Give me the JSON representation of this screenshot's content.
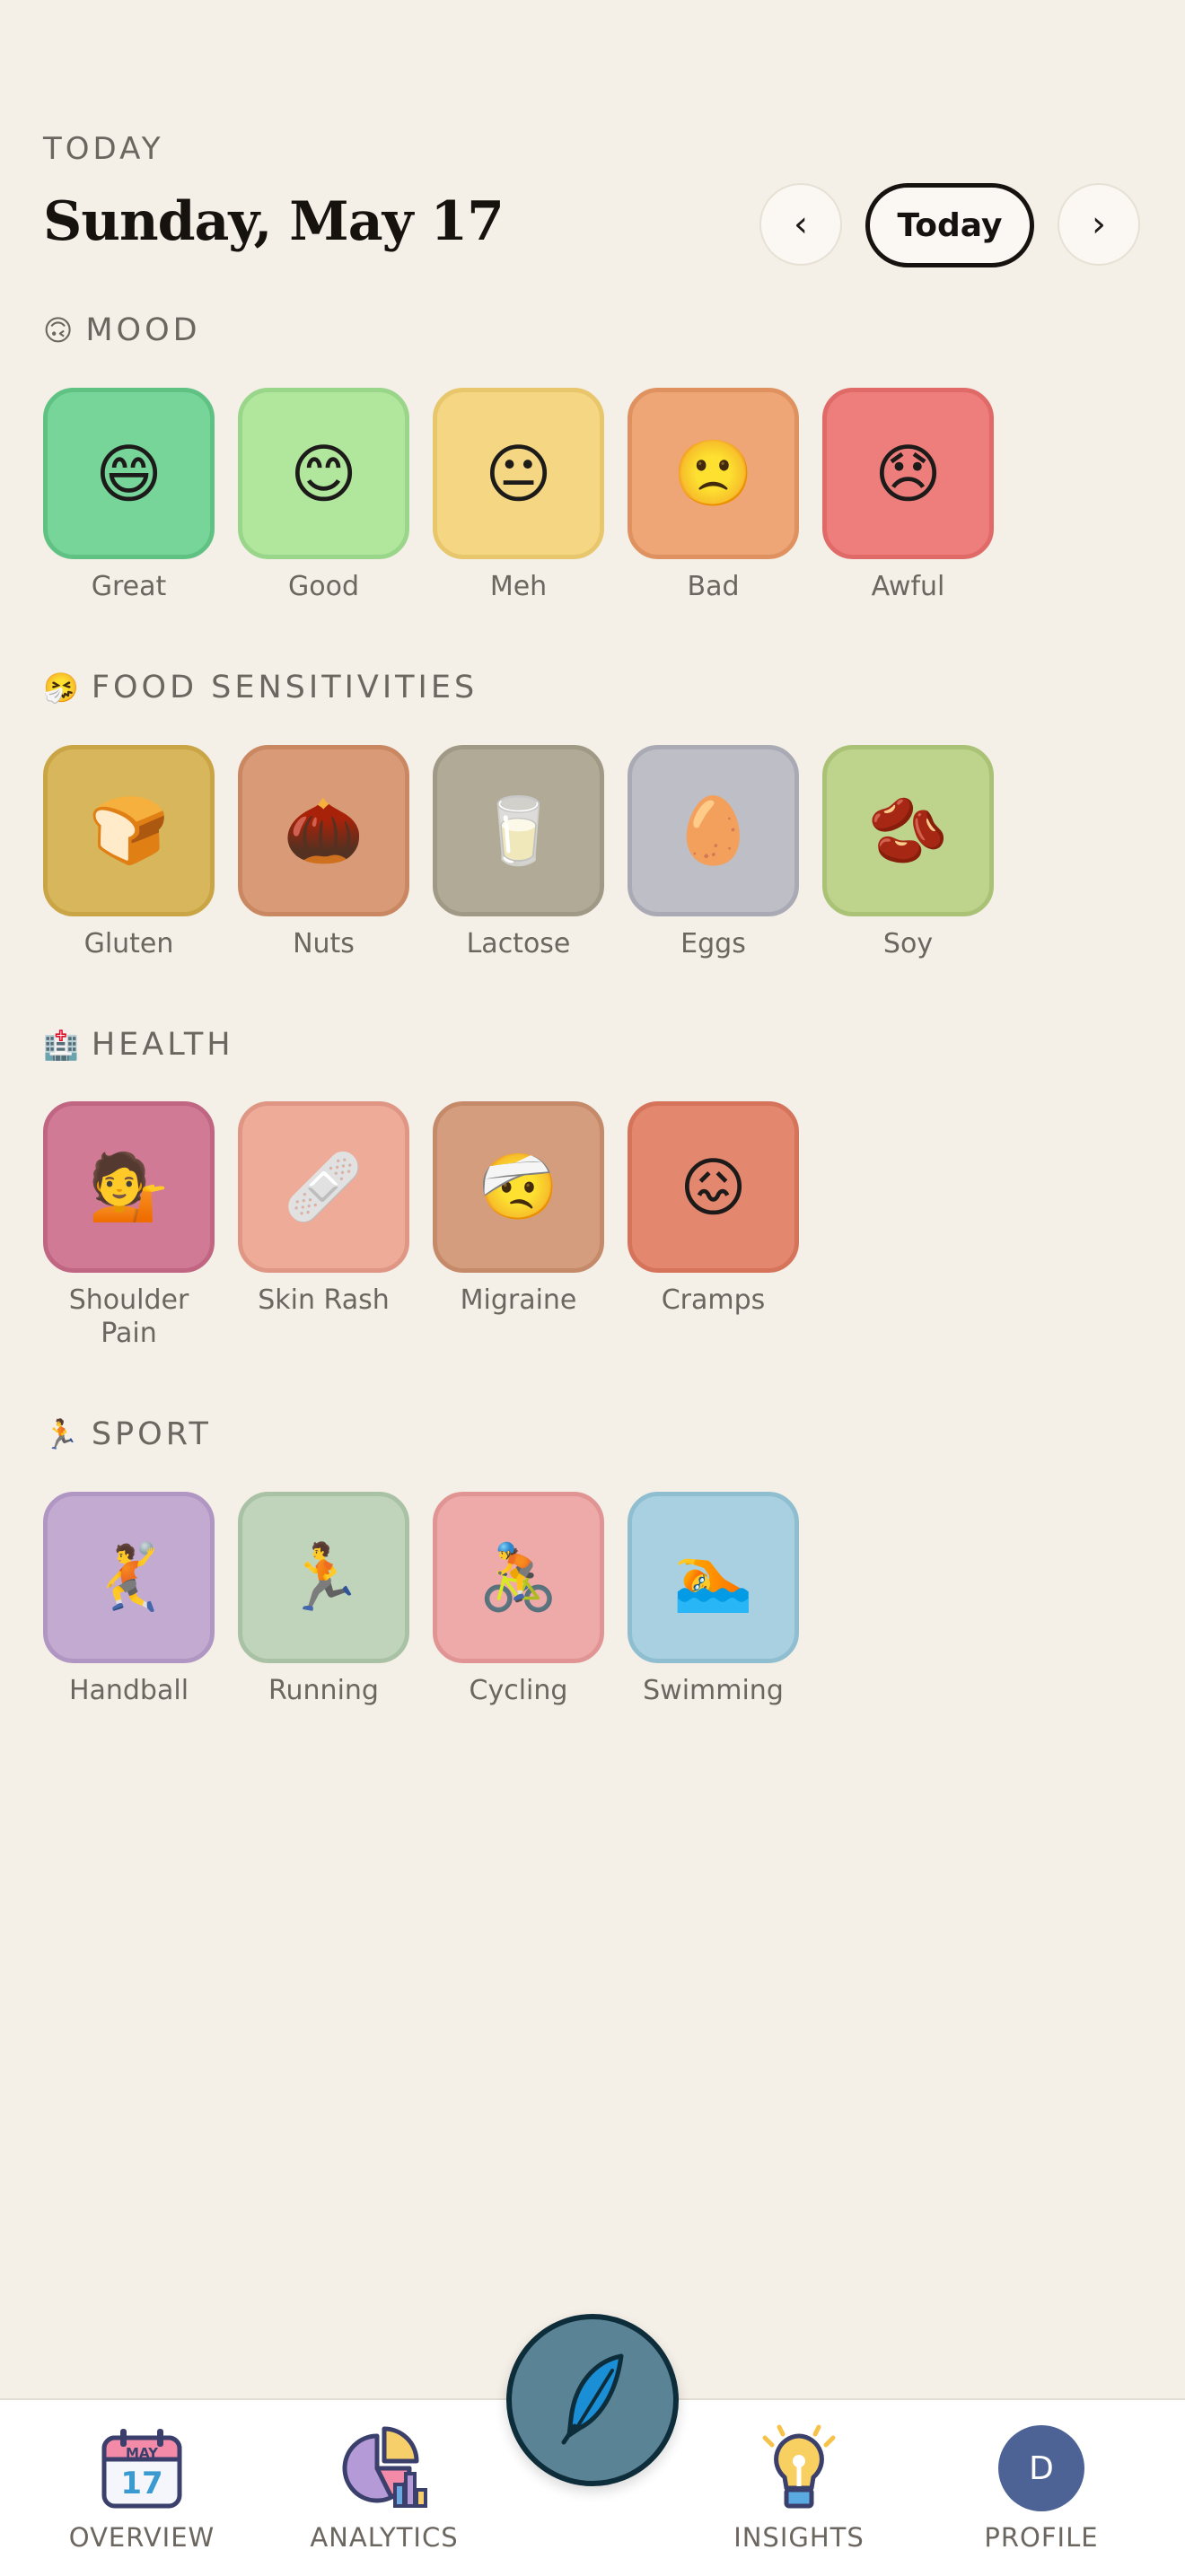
{
  "header": {
    "eyebrow": "TODAY",
    "date_title": "Sunday, May 17",
    "prev_label": "‹",
    "today_label": "Today",
    "next_label": "›"
  },
  "sections": {
    "mood": {
      "icon": "🙃",
      "title": "MOOD",
      "items": [
        {
          "label": "Great",
          "emoji": "😄",
          "bg": "#77d59a",
          "border": "#5fc283"
        },
        {
          "label": "Good",
          "emoji": "😊",
          "bg": "#b1e69d",
          "border": "#9ad68a"
        },
        {
          "label": "Meh",
          "emoji": "😐",
          "bg": "#f5d682",
          "border": "#e8c66b"
        },
        {
          "label": "Bad",
          "emoji": "🙁",
          "bg": "#eea677",
          "border": "#df925f"
        },
        {
          "label": "Awful",
          "emoji": "😞",
          "bg": "#ed7e7b",
          "border": "#e06a68"
        }
      ]
    },
    "food": {
      "icon": "🤧",
      "title": "FOOD SENSITIVITIES",
      "items": [
        {
          "label": "Gluten",
          "emoji": "🍞",
          "bg": "#d8b65b",
          "border": "#c9a546"
        },
        {
          "label": "Nuts",
          "emoji": "🌰",
          "bg": "#d99b77",
          "border": "#c98862"
        },
        {
          "label": "Lactose",
          "emoji": "🥛",
          "bg": "#b0aa97",
          "border": "#9f9985"
        },
        {
          "label": "Eggs",
          "emoji": "🥚",
          "bg": "#bdbec6",
          "border": "#a9aab4"
        },
        {
          "label": "Soy",
          "emoji": "🫘",
          "bg": "#bed38c",
          "border": "#a9c275"
        }
      ]
    },
    "health": {
      "icon": "🏥",
      "title": "HEALTH",
      "items": [
        {
          "label": "Shoulder Pain",
          "emoji": "💁",
          "bg": "#d07a95",
          "border": "#c06582"
        },
        {
          "label": "Skin Rash",
          "emoji": "🩹",
          "bg": "#edab98",
          "border": "#df9684"
        },
        {
          "label": "Migraine",
          "emoji": "🤕",
          "bg": "#d49e7e",
          "border": "#c48a69"
        },
        {
          "label": "Cramps",
          "emoji": "😖",
          "bg": "#e4876f",
          "border": "#d5735b"
        }
      ]
    },
    "sport": {
      "icon": "🏃",
      "title": "SPORT",
      "items": [
        {
          "label": "Handball",
          "emoji": "🤾",
          "bg": "#c3aad1",
          "border": "#b096c2"
        },
        {
          "label": "Running",
          "emoji": "🏃",
          "bg": "#c0d4bb",
          "border": "#a9c1a4"
        },
        {
          "label": "Cycling",
          "emoji": "🚴",
          "bg": "#eeaaa8",
          "border": "#e09594"
        },
        {
          "label": "Swimming",
          "emoji": "🏊",
          "bg": "#a9d0e0",
          "border": "#8fbed0"
        }
      ]
    }
  },
  "tabbar": {
    "overview": {
      "label": "OVERVIEW",
      "cal_month": "MAY",
      "cal_day": "17"
    },
    "analytics": {
      "label": "ANALYTICS"
    },
    "insights": {
      "label": "INSIGHTS"
    },
    "profile": {
      "label": "PROFILE",
      "avatar_initial": "D"
    }
  },
  "colors": {
    "background": "#f4efe7",
    "fab": "#5a8496",
    "fab_border": "#0e2d3a",
    "avatar": "#4e6395"
  },
  "icons": {
    "fab": "feather-icon",
    "overview": "calendar-icon",
    "analytics": "pie-chart-icon",
    "insights": "lightbulb-icon"
  }
}
